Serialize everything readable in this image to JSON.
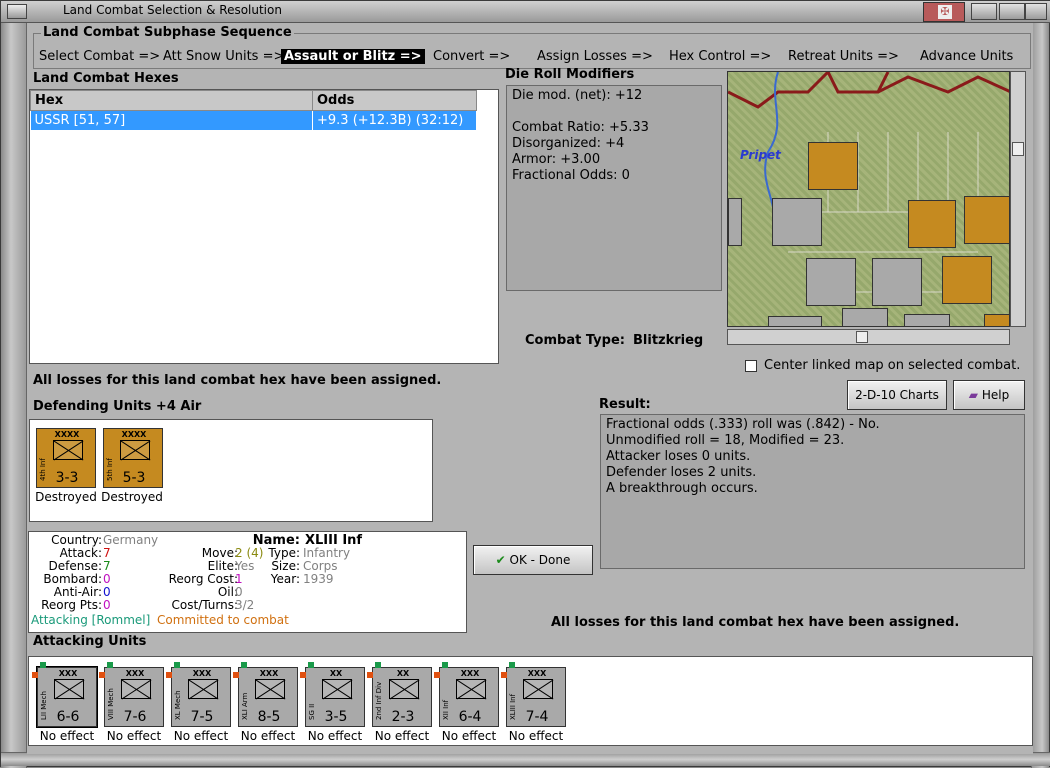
{
  "window": {
    "title": "Land Combat Selection & Resolution"
  },
  "sequence": {
    "title": "Land Combat Subphase Sequence",
    "steps": [
      "Select Combat =>",
      "Att Snow Units =>",
      "Assault or Blitz =>",
      "Convert =>",
      "Assign Losses =>",
      "Hex Control =>",
      "Retreat Units =>",
      "Advance Units"
    ]
  },
  "hexes": {
    "title": "Land Combat Hexes",
    "columns": [
      "Hex",
      "Odds"
    ],
    "rows": [
      {
        "hex": "USSR [51, 57]",
        "odds": "+9.3 (+12.3B) (32:12)"
      }
    ],
    "losses_msg": "All losses for this land combat hex have been assigned."
  },
  "modifiers": {
    "title": "Die Roll Modifiers",
    "lines": [
      "Die mod. (net): +12",
      "",
      "Combat Ratio: +5.33",
      "Disorganized: +4",
      "Armor: +3.00",
      "Fractional Odds: 0"
    ]
  },
  "combat_type": {
    "label": "Combat Type:",
    "value": "Blitzkrieg"
  },
  "map": {
    "river": "Pripet",
    "center_label": "Center linked map on selected combat."
  },
  "buttons": {
    "charts": "2-D-10 Charts",
    "help": "Help",
    "ok": "OK - Done"
  },
  "result": {
    "title": "Result:",
    "lines": [
      "Fractional odds (.333) roll was (.842)  - No.",
      "Unmodified roll = 18, Modified = 23.",
      "Attacker loses 0 units.",
      "Defender loses 2 units.",
      "A breakthrough occurs."
    ],
    "losses_msg": "All losses for this land combat hex have been assigned."
  },
  "defenders": {
    "title": "Defending Units +4 Air",
    "units": [
      {
        "size": "XXXX",
        "name": "4th Inf",
        "str": "3-3",
        "status": "Destroyed"
      },
      {
        "size": "XXXX",
        "name": "5th Inf",
        "str": "5-3",
        "status": "Destroyed"
      }
    ]
  },
  "info": {
    "country_l": "Country:",
    "country": "Germany",
    "attack_l": "Attack:",
    "attack": "7",
    "defense_l": "Defense:",
    "defense": "7",
    "bombard_l": "Bombard:",
    "bombard": "0",
    "antiair_l": "Anti-Air:",
    "antiair": "0",
    "reorg_l": "Reorg Pts:",
    "reorg": "0",
    "name_l": "Name:",
    "name": "XLIII Inf",
    "move_l": "Move:",
    "move": "2 (4)",
    "type_l": "Type:",
    "type": "Infantry",
    "elite_l": "Elite:",
    "elite": "Yes",
    "size_l": "Size:",
    "size": "Corps",
    "reorgcost_l": "Reorg Cost:",
    "reorgcost": "1",
    "year_l": "Year:",
    "year": "1939",
    "oil_l": "Oil:",
    "oil": "0",
    "cost_l": "Cost/Turns:",
    "cost": "3/2",
    "attacking": "Attacking [Rommel]",
    "committed": "Committed to combat"
  },
  "attackers": {
    "title": "Attacking Units",
    "units": [
      {
        "size": "XXX",
        "name": "LII Mech",
        "str": "6-6",
        "status": "No effect"
      },
      {
        "size": "XXX",
        "name": "VIII Mech",
        "str": "7-6",
        "status": "No effect"
      },
      {
        "size": "XXX",
        "name": "XL Mech",
        "str": "7-5",
        "status": "No effect"
      },
      {
        "size": "XXX",
        "name": "XLI Arm",
        "str": "8-5",
        "status": "No effect"
      },
      {
        "size": "XX",
        "name": "SG II",
        "str": "3-5",
        "status": "No effect"
      },
      {
        "size": "XX",
        "name": "2nd Inf Div",
        "str": "2-3",
        "status": "No effect"
      },
      {
        "size": "XXX",
        "name": "XII Inf",
        "str": "6-4",
        "status": "No effect"
      },
      {
        "size": "XXX",
        "name": "XLIII Inf",
        "str": "7-4",
        "status": "No effect"
      }
    ]
  },
  "colors": {
    "selection": "#3399ff",
    "axis_counter": "#a9a9a9",
    "soviet_counter": "#c58a20"
  }
}
